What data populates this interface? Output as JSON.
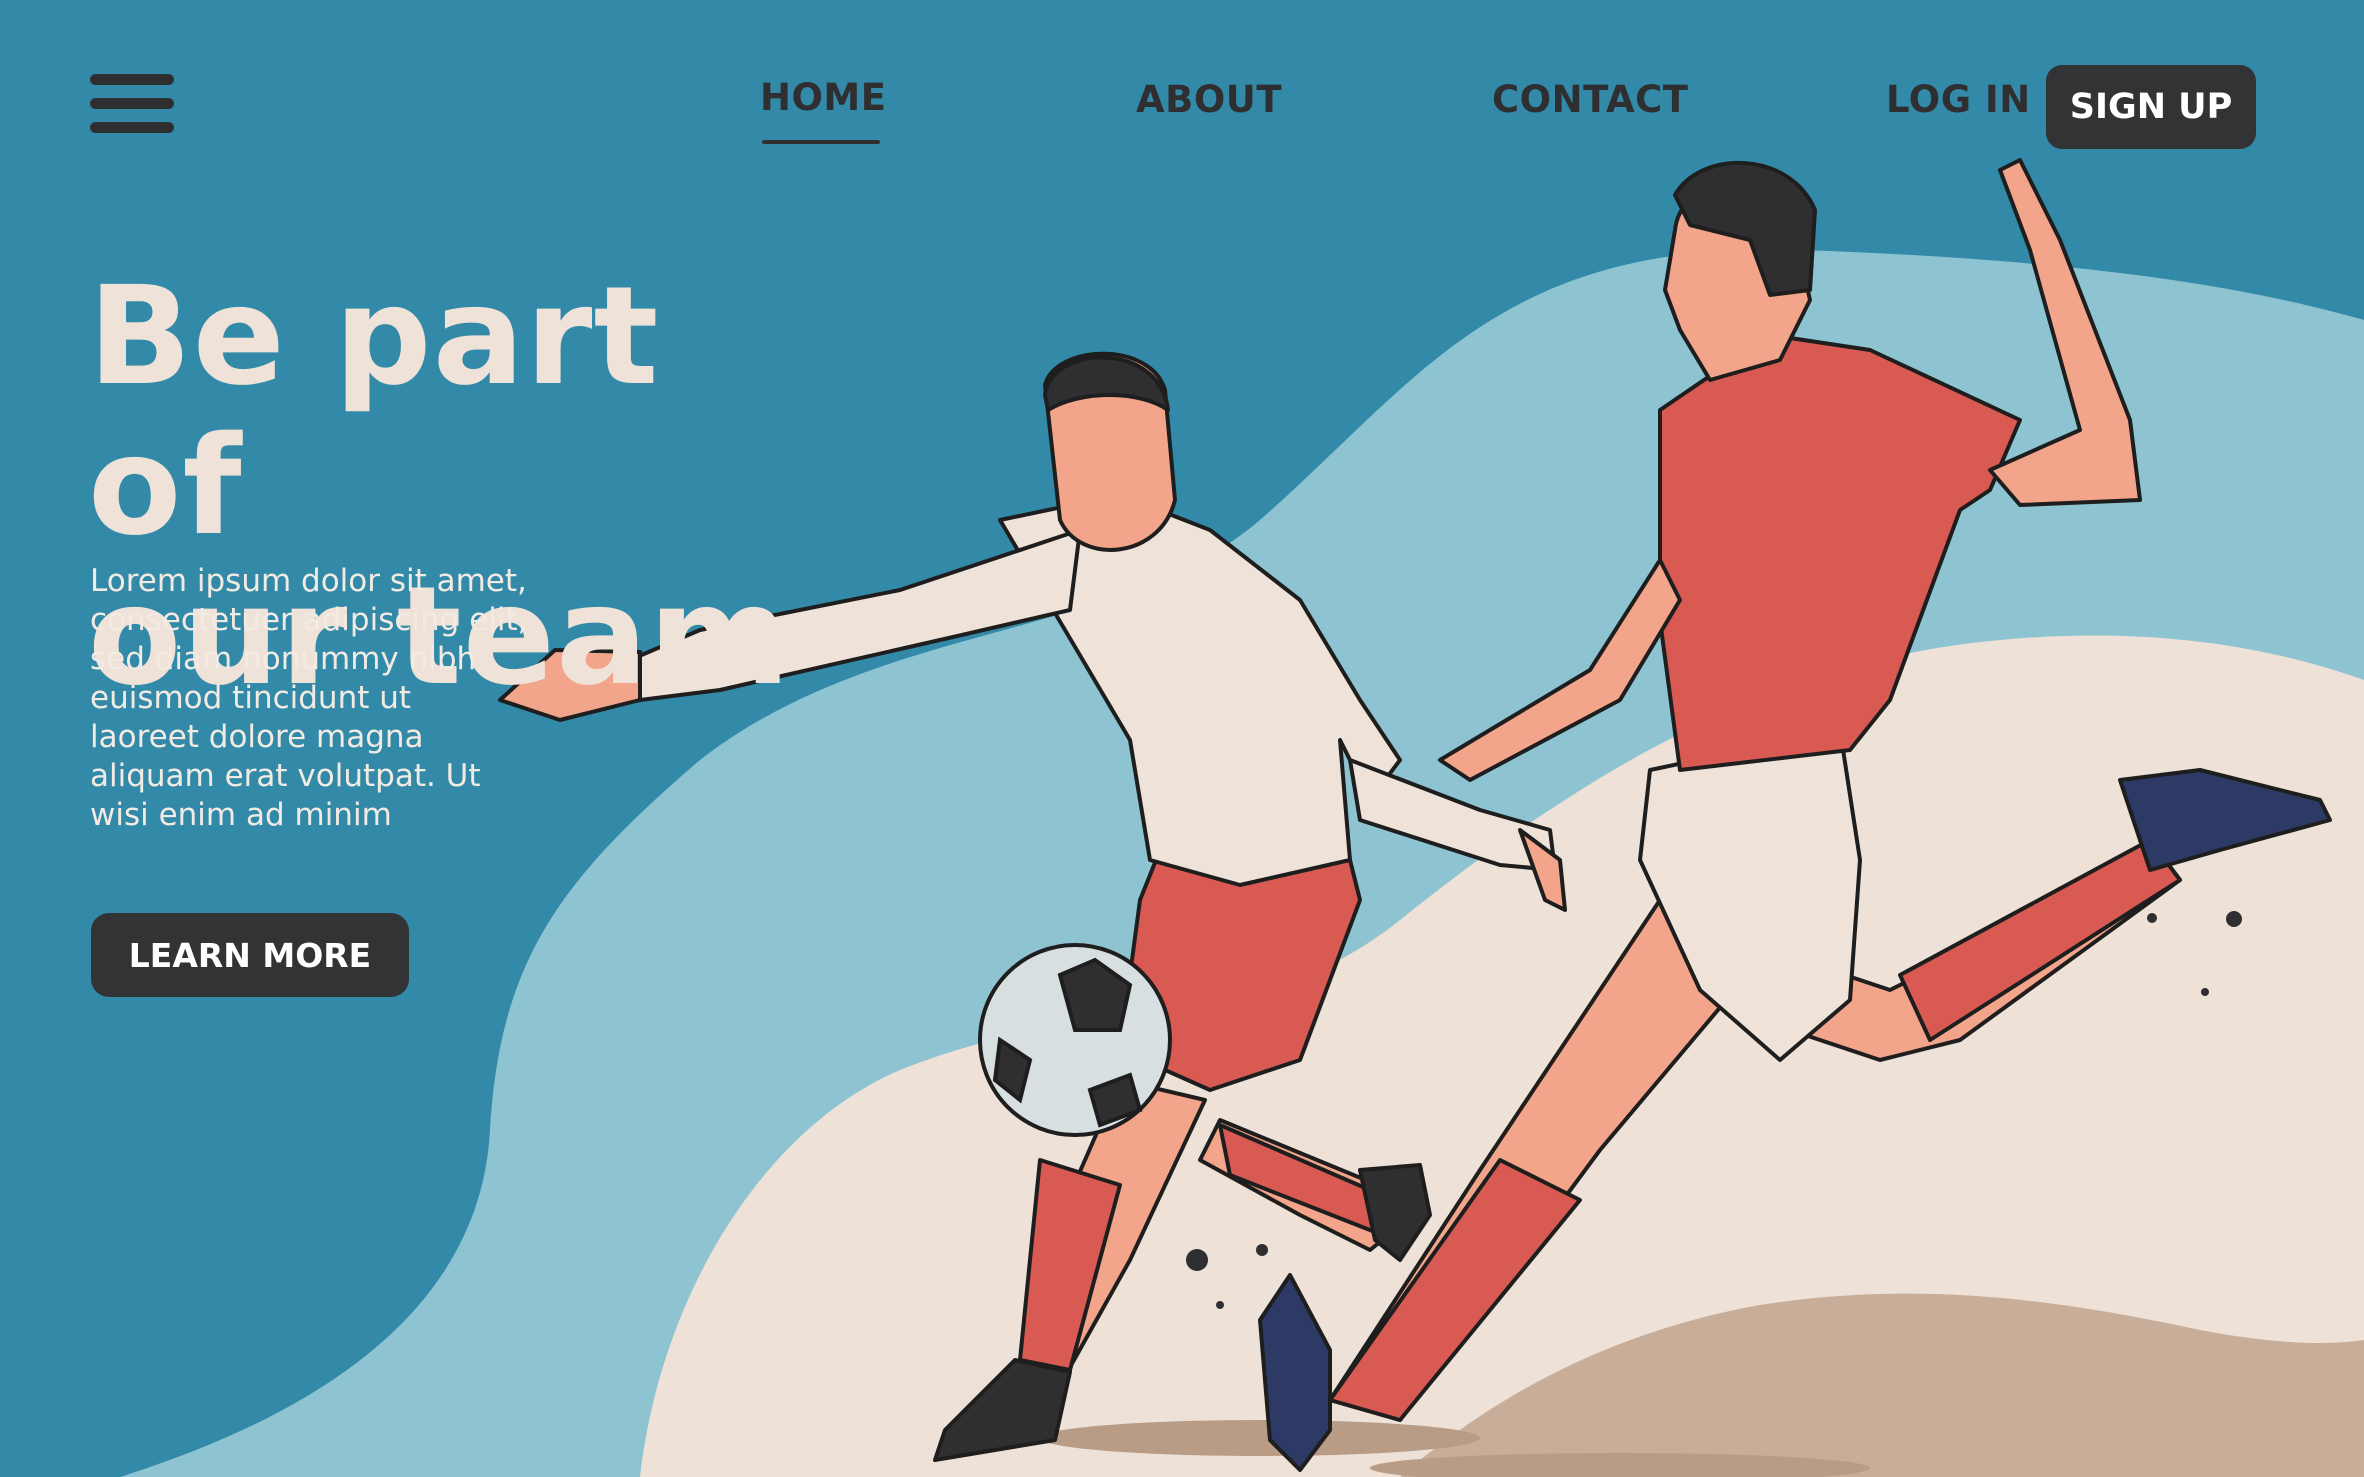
{
  "nav": {
    "menu_icon": "hamburger-menu-icon",
    "links": [
      "HOME",
      "ABOUT",
      "CONTACT"
    ],
    "active": "HOME",
    "login_label": "LOG IN",
    "signup_label": "SIGN UP"
  },
  "hero": {
    "headline_line1": "Be part of",
    "headline_line2": "our team",
    "body_lines": [
      "Lorem ipsum dolor sit amet,",
      "consectetuer adipiscing elit,",
      "sed diam nonummy nibh",
      "euismod tincidunt ut",
      "laoreet dolore magna",
      "aliquam erat volutpat. Ut",
      "wisi enim ad minim"
    ],
    "cta_label": "LEARN MORE"
  },
  "colors": {
    "background": "#338aa8",
    "light_blue": "#8ec4d2",
    "sand": "#eee1d7",
    "dark_sand": "#c8ae98",
    "button": "#333336",
    "headline": "#efe2d8",
    "jersey_red": "#d95a53"
  },
  "illustration": {
    "subject": "two-soccer-players-illustration"
  }
}
